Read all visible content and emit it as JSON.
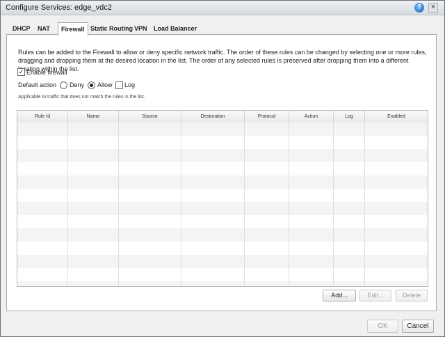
{
  "window": {
    "title": "Configure Services: edge_vdc2",
    "help_icon": "?",
    "close_icon": "×"
  },
  "tabs": [
    {
      "label": "DHCP",
      "active": false
    },
    {
      "label": "NAT",
      "active": false
    },
    {
      "label": "Firewall",
      "active": true
    },
    {
      "label": "Static Routing",
      "active": false
    },
    {
      "label": "VPN",
      "active": false
    },
    {
      "label": "Load Balancer",
      "active": false
    }
  ],
  "firewall": {
    "description": "Rules can be added to the Firewall to allow or deny specific network traffic. The order of these rules can be changed by selecting one or more rules, dragging and dropping them at the desired location in the list. The order of any selected rules is preserved after dropping them into a different location within the list.",
    "enable_label": "Enable firewall",
    "enable_checked": true,
    "default_action_label": "Default action",
    "deny_label": "Deny",
    "allow_label": "Allow",
    "log_label": "Log",
    "selected_action": "Allow",
    "log_checked": false,
    "note": "Applicable to traffic that does not match the rules in the list.",
    "columns": [
      "Rule Id",
      "Name",
      "Source",
      "Destination",
      "Protocol",
      "Action",
      "Log",
      "Enabled"
    ]
  },
  "grid_buttons": {
    "add": "Add...",
    "edit": "Edit...",
    "delete": "Delete"
  },
  "footer": {
    "ok": "OK",
    "cancel": "Cancel"
  }
}
